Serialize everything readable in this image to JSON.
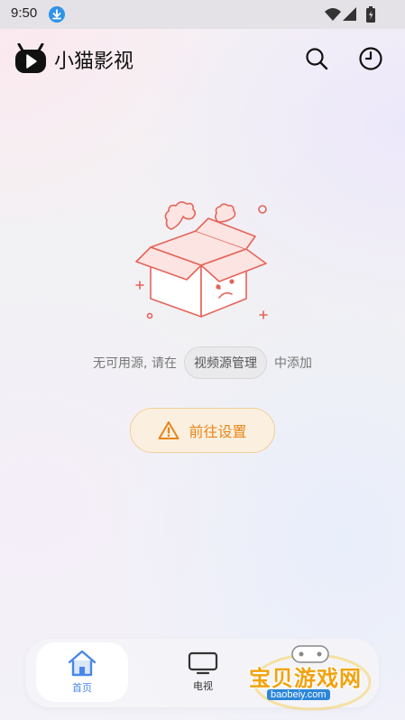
{
  "status_bar": {
    "time": "9:50",
    "icons": [
      "download-icon",
      "wifi-icon",
      "signal-icon",
      "battery-icon"
    ]
  },
  "header": {
    "title": "小猫影视",
    "actions": [
      "search-icon",
      "history-icon"
    ]
  },
  "empty_state": {
    "message_prefix": "无可用源, 请在",
    "source_chip": "视频源管理",
    "message_suffix": "中添加",
    "settings_button": "前往设置"
  },
  "bottom_nav": {
    "items": [
      {
        "label": "首页",
        "icon": "home-icon",
        "active": true
      },
      {
        "label": "电视",
        "icon": "tv-icon",
        "active": false
      }
    ]
  },
  "watermark": {
    "text": "宝贝游戏网",
    "url": "baobeiy.com"
  },
  "colors": {
    "accent_blue": "#4a87e8",
    "warning_orange": "#e9841a",
    "illustration_red": "#e5645a"
  }
}
